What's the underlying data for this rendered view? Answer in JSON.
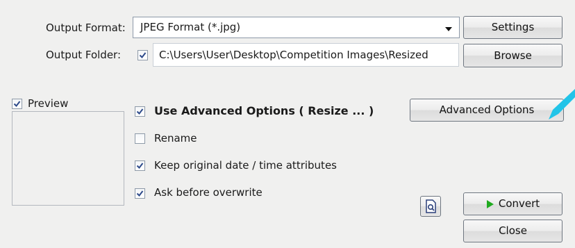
{
  "output_format": {
    "label": "Output Format:",
    "selected": "JPEG Format (*.jpg)"
  },
  "output_folder": {
    "label": "Output Folder:",
    "checked": true,
    "path": "C:\\Users\\User\\Desktop\\Competition Images\\Resized"
  },
  "buttons": {
    "settings": "Settings",
    "browse": "Browse",
    "advanced": "Advanced Options",
    "convert": "Convert",
    "close": "Close"
  },
  "preview": {
    "label": "Preview",
    "checked": true
  },
  "options": [
    {
      "label": "Use Advanced Options ( Resize ... )",
      "checked": true,
      "bold": true
    },
    {
      "label": "Rename",
      "checked": false
    },
    {
      "label": "Keep original date / time attributes",
      "checked": true
    },
    {
      "label": "Ask before overwrite",
      "checked": true
    }
  ],
  "icons": {
    "dropdown": "chevron-down-icon",
    "preview": "document-magnifier-icon",
    "convert": "play-icon",
    "annotation": "cyan-arrow"
  },
  "colors": {
    "accent_arrow": "#22c4e8",
    "convert_icon": "#1faa1f",
    "check": "#2d4a8a"
  }
}
